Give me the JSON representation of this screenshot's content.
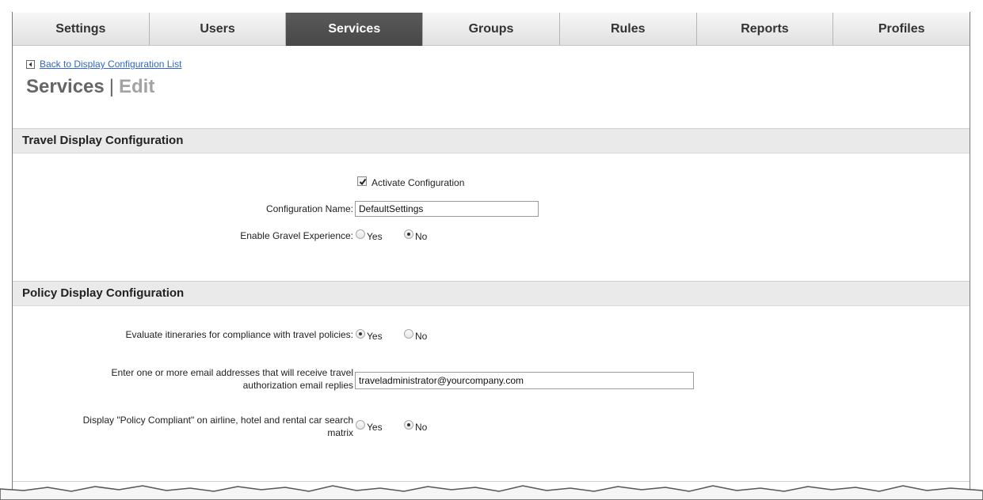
{
  "tabs": [
    {
      "label": "Settings",
      "active": false
    },
    {
      "label": "Users",
      "active": false
    },
    {
      "label": "Services",
      "active": true
    },
    {
      "label": "Groups",
      "active": false
    },
    {
      "label": "Rules",
      "active": false
    },
    {
      "label": "Reports",
      "active": false
    },
    {
      "label": "Profiles",
      "active": false
    }
  ],
  "back_link": "Back to Display Configuration List",
  "page_title": {
    "main": "Services",
    "separator": "|",
    "sub": "Edit"
  },
  "travel_section": {
    "title": "Travel Display Configuration",
    "activate_label": "Activate Configuration",
    "activate_checked": true,
    "config_name_label": "Configuration Name:",
    "config_name_value": "DefaultSettings",
    "gravel_label": "Enable Gravel Experience:",
    "gravel_yes": "Yes",
    "gravel_no": "No",
    "gravel_selected": "No"
  },
  "policy_section": {
    "title": "Policy Display Configuration",
    "evaluate_label": "Evaluate itineraries for compliance with travel policies:",
    "evaluate_yes": "Yes",
    "evaluate_no": "No",
    "evaluate_selected": "Yes",
    "email_label_line1": "Enter one or more email addresses that will receive travel",
    "email_label_line2": "authorization email replies",
    "email_value": "traveladministrator@yourcompany.com",
    "compliant_label_line1": "Display \"Policy Compliant\" on airline, hotel and rental car search",
    "compliant_label_line2": "matrix",
    "compliant_yes": "Yes",
    "compliant_no": "No",
    "compliant_selected": "No"
  },
  "icons": {
    "back": "back-arrow-icon",
    "check": "checkmark-icon"
  }
}
